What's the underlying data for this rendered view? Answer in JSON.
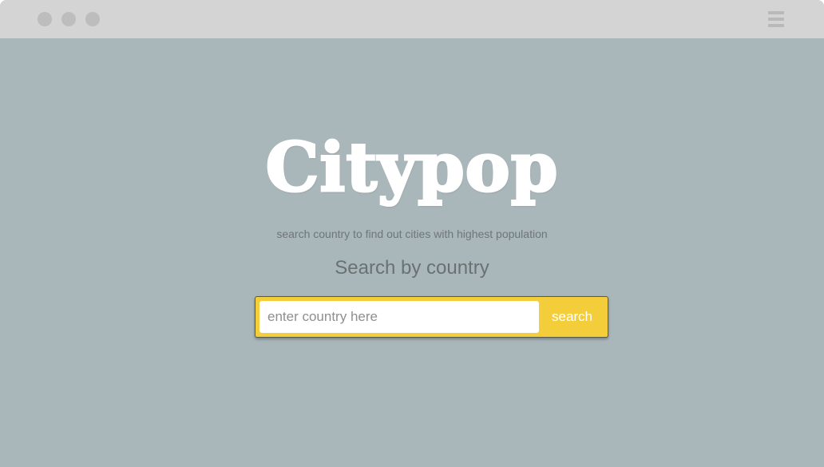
{
  "window": {
    "controls": [
      "window-dot",
      "window-dot",
      "window-dot"
    ],
    "menu_icon": "hamburger-menu-icon"
  },
  "hero": {
    "logo": "Citypop",
    "tagline": "search country to find out cities with highest population",
    "heading": "Search by country"
  },
  "search": {
    "placeholder": "enter country here",
    "value": "",
    "button_label": "search"
  },
  "colors": {
    "background": "#a9b6ba",
    "titlebar": "#d4d4d4",
    "accent": "#f4cd3b",
    "logo": "#ffffff"
  }
}
